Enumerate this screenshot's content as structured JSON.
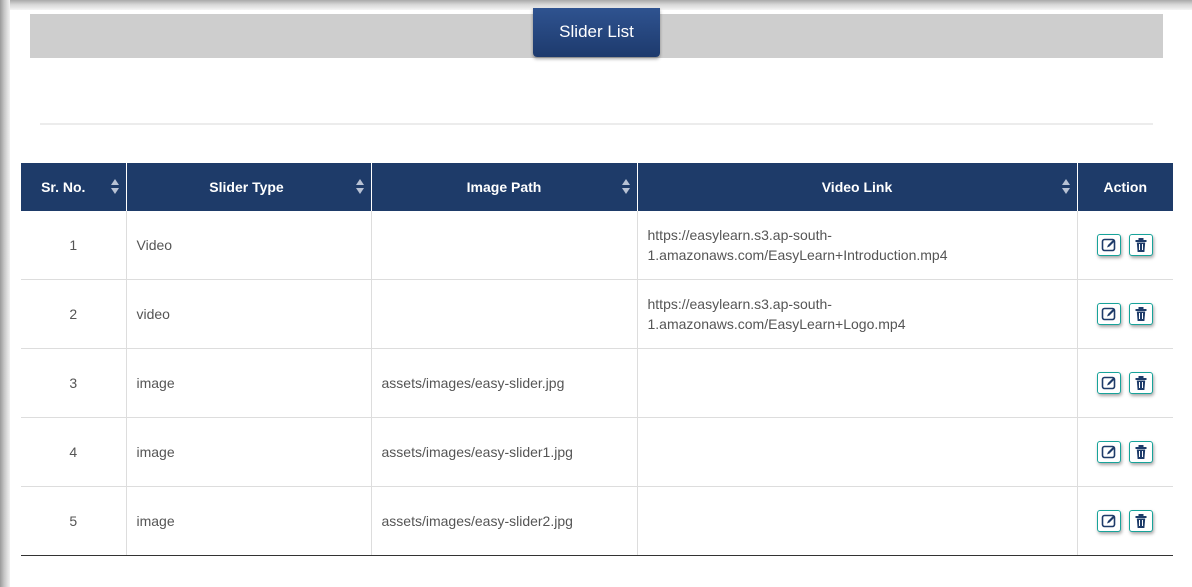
{
  "page": {
    "title": "Slider List"
  },
  "table": {
    "headers": {
      "sr_no": "Sr. No.",
      "slider_type": "Slider Type",
      "image_path": "Image Path",
      "video_link": "Video Link",
      "action": "Action"
    },
    "rows": [
      {
        "sr": "1",
        "type": "Video",
        "image": "",
        "video": "https://easylearn.s3.ap-south-1.amazonaws.com/EasyLearn+Introduction.mp4"
      },
      {
        "sr": "2",
        "type": "video",
        "image": "",
        "video": "https://easylearn.s3.ap-south-1.amazonaws.com/EasyLearn+Logo.mp4"
      },
      {
        "sr": "3",
        "type": "image",
        "image": "assets/images/easy-slider.jpg",
        "video": ""
      },
      {
        "sr": "4",
        "type": "image",
        "image": "assets/images/easy-slider1.jpg",
        "video": ""
      },
      {
        "sr": "5",
        "type": "image",
        "image": "assets/images/easy-slider2.jpg",
        "video": ""
      }
    ],
    "row_actions": [
      "edit-icon",
      "delete-icon"
    ]
  },
  "colors": {
    "header_bg": "#1e3b69",
    "title_tab": "#2a4c86",
    "action_border": "#17a39a",
    "band": "#cecece"
  }
}
